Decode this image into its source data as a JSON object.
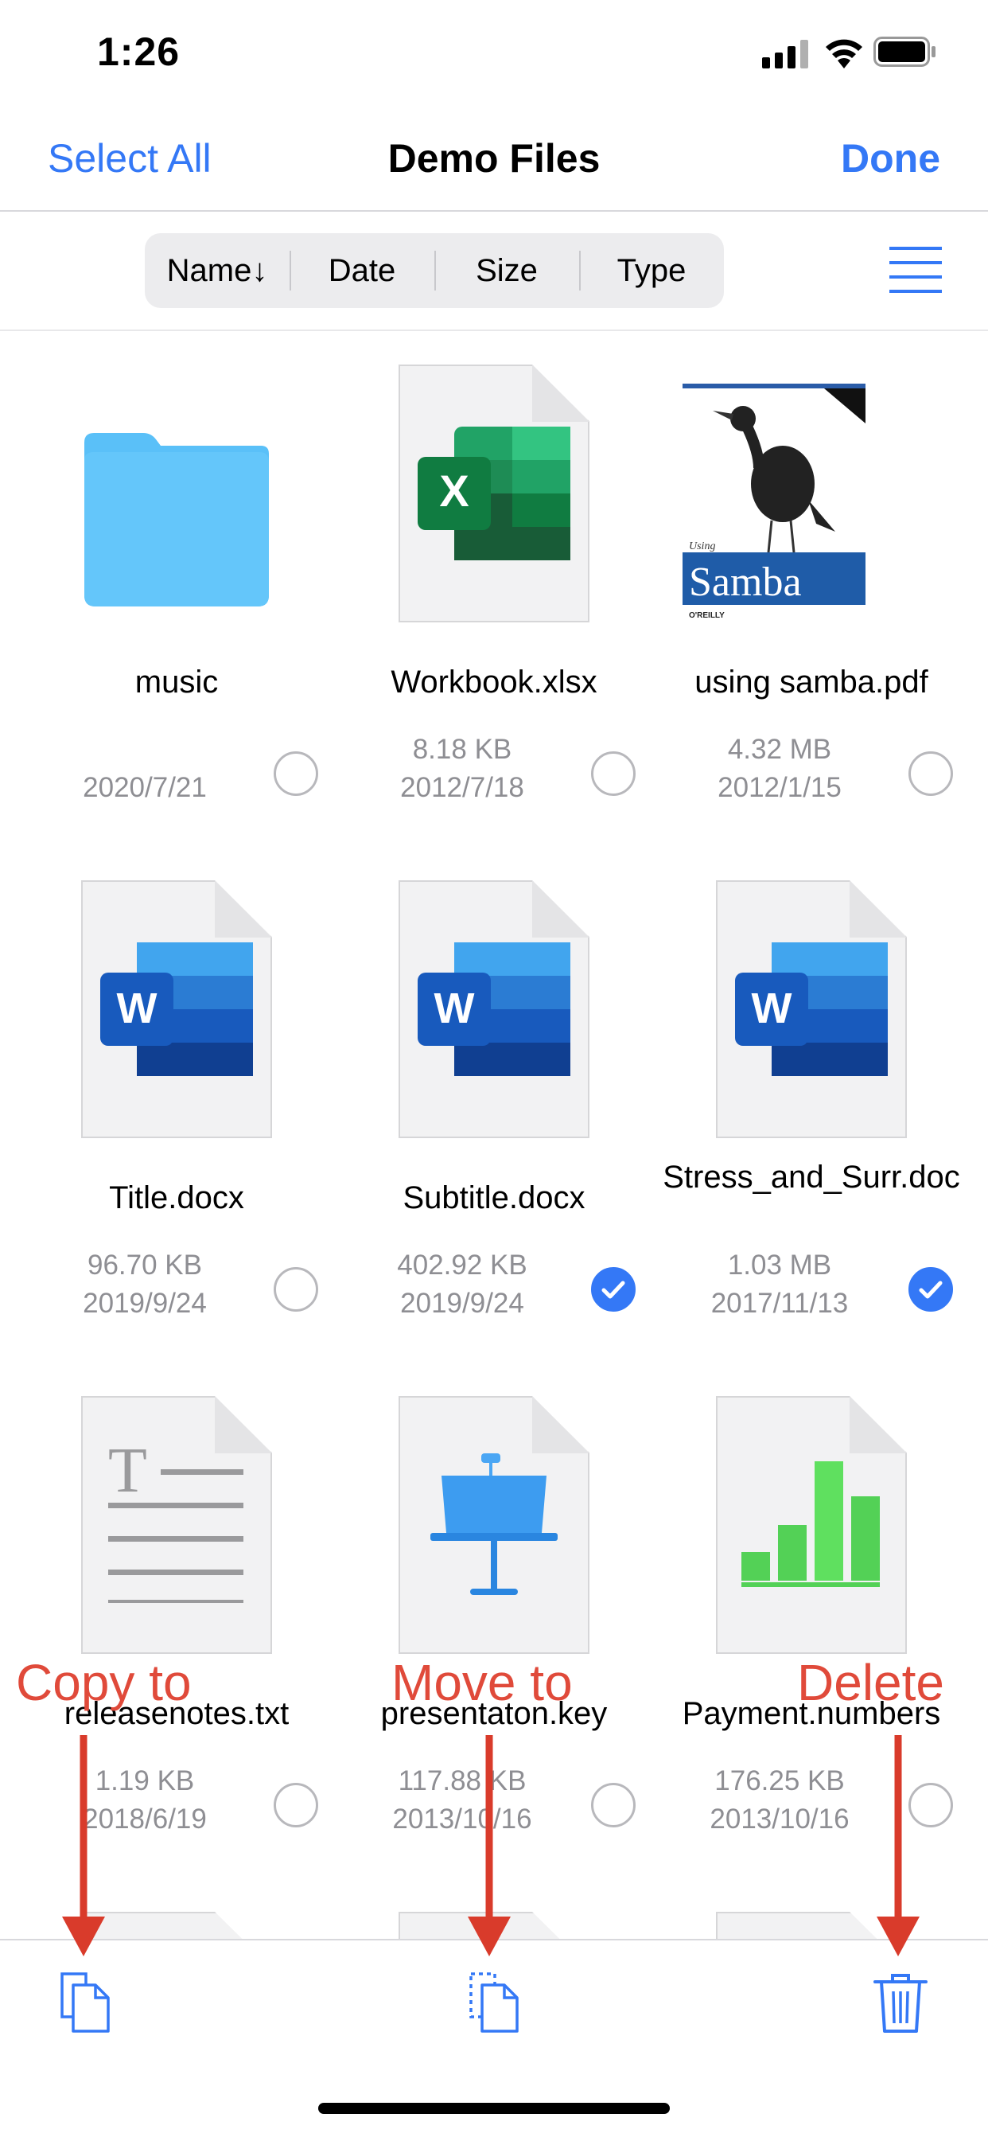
{
  "status_bar": {
    "time": "1:26"
  },
  "nav": {
    "left_button": "Select All",
    "title": "Demo Files",
    "right_button": "Done"
  },
  "sort": {
    "options": [
      "Name↓",
      "Date",
      "Size",
      "Type"
    ]
  },
  "files": [
    {
      "name": "music",
      "size": "",
      "date": "2020/7/21",
      "type": "folder",
      "selected": false
    },
    {
      "name": "Workbook.xlsx",
      "size": "8.18 KB",
      "date": "2012/7/18",
      "type": "excel",
      "selected": false
    },
    {
      "name": "using samba.pdf",
      "size": "4.32 MB",
      "date": "2012/1/15",
      "type": "pdf",
      "selected": false
    },
    {
      "name": "Title.docx",
      "size": "96.70 KB",
      "date": "2019/9/24",
      "type": "word",
      "selected": false
    },
    {
      "name": "Subtitle.docx",
      "size": "402.92 KB",
      "date": "2019/9/24",
      "type": "word",
      "selected": true
    },
    {
      "name": "Stress_and_Surr.doc",
      "size": "1.03 MB",
      "date": "2017/11/13",
      "type": "word",
      "selected": true
    },
    {
      "name": "releasenotes.txt",
      "size": "1.19 KB",
      "date": "2018/6/19",
      "type": "text",
      "selected": false
    },
    {
      "name": "presentaton.key",
      "size": "117.88 KB",
      "date": "2013/10/16",
      "type": "keynote",
      "selected": false
    },
    {
      "name": "Payment.numbers",
      "size": "176.25 KB",
      "date": "2013/10/16",
      "type": "numbers",
      "selected": false
    }
  ],
  "pdf_cover": {
    "title": "Samba",
    "subtitle": "Using",
    "publisher": "O'REILLY"
  },
  "annotations": {
    "copy": "Copy to",
    "move": "Move to",
    "delete": "Delete"
  },
  "colors": {
    "accent": "#3478f6",
    "annotation": "#e04a3a",
    "folder": "#5ac0f8"
  },
  "icons": {
    "copy": "copy-icon",
    "move": "move-icon",
    "delete": "trash-icon"
  }
}
